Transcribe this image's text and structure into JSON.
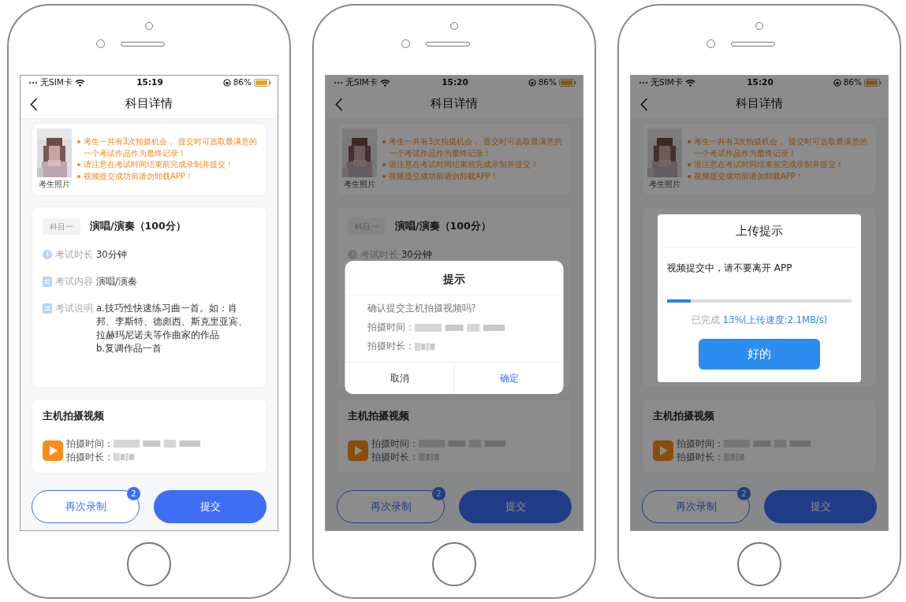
{
  "phones": [
    {
      "status_bar": {
        "carrier": "无SIM卡",
        "time": "15:19",
        "battery": "86%"
      },
      "nav_title": "科目详情",
      "notice": {
        "photo_caption": "考生照片",
        "items": [
          "考生一共有3次拍摄机会， 提交时可选取最满意的一个考试作品作为最终记录！",
          "请注意在考试时间结束前完成录制并提交！",
          "视频提交成功前请勿卸载APP！"
        ]
      },
      "subject": {
        "tag": "科目一",
        "title": "演唱/演奏（100分）",
        "rows": [
          {
            "kind": "clock",
            "label": "考试时长",
            "lines": [
              "30分钟"
            ]
          },
          {
            "kind": "doc",
            "label": "考试内容",
            "lines": [
              "演唱/演奏"
            ]
          },
          {
            "kind": "doc",
            "label": "考试说明",
            "lines": [
              "a.技巧性快速练习曲一首。如：肖邦、李斯特、德彪西、斯克里亚宾、拉赫玛尼诺夫等作曲家的作品",
              "b.复调作品一首"
            ]
          }
        ]
      },
      "video": {
        "title": "主机拍摄视频",
        "time_label": "拍摄时间：",
        "duration_label": "拍摄时长："
      },
      "actions": {
        "rerecord": "再次录制",
        "badge": "2",
        "submit": "提交"
      },
      "dimmed": false
    },
    {
      "status_bar": {
        "carrier": "无SIM卡",
        "time": "15:20",
        "battery": "86%"
      },
      "nav_title": "科目详情",
      "notice": {
        "photo_caption": "考生照片",
        "items": [
          "考生一共有3次拍摄机会， 提交时可选取最满意的一个考试作品作为最终记录！",
          "请注意在考试时间结束前完成录制并提交！",
          "视频提交成功前请勿卸载APP！"
        ]
      },
      "subject": {
        "tag": "科目一",
        "title": "演唱/演奏（100分）",
        "rows": [
          {
            "kind": "clock",
            "label": "考试时长",
            "lines": [
              "30分钟"
            ]
          }
        ]
      },
      "video": {
        "title": "主机拍摄视频",
        "time_label": "拍摄时间：",
        "duration_label": "拍摄时长："
      },
      "actions": {
        "rerecord": "再次录制",
        "badge": "2",
        "submit": "提交"
      },
      "dimmed": true,
      "dialog": {
        "kind": "confirm",
        "title": "提示",
        "question": "确认提交主机拍摄视频吗?",
        "time_label": "拍摄时间：",
        "duration_label": "拍摄时长：",
        "cancel": "取消",
        "ok": "确定"
      }
    },
    {
      "status_bar": {
        "carrier": "无SIM卡",
        "time": "15:20",
        "battery": "86%"
      },
      "nav_title": "科目详情",
      "notice": {
        "photo_caption": "考生照片",
        "items": [
          "考生一共有3次拍摄机会， 提交时可选取最满意的一个考试作品作为最终记录！",
          "请注意在考试时间结束前完成录制并提交！",
          "视频提交成功前请勿卸载APP！"
        ]
      },
      "video": {
        "title": "主机拍摄视频",
        "time_label": "拍摄时间：",
        "duration_label": "拍摄时长："
      },
      "actions": {
        "rerecord": "再次录制",
        "badge": "2",
        "submit": "提交"
      },
      "dimmed": true,
      "dialog": {
        "kind": "progress",
        "title": "上传提示",
        "message": "视频提交中，请不要离开 APP",
        "level": 0.13,
        "status_label": "已完成",
        "status_value": "13%(上传速度:2.1MB/s)",
        "ok": "好的"
      }
    }
  ]
}
